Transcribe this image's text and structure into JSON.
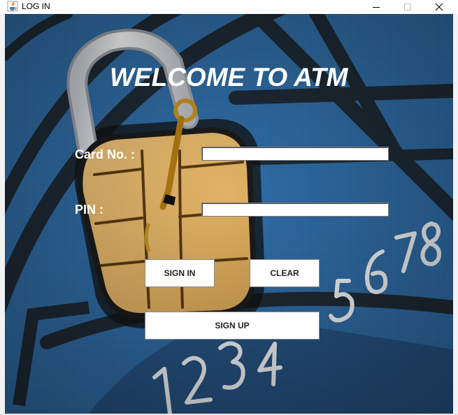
{
  "window": {
    "title": "LOG IN",
    "icons": {
      "app": "java-cup-icon",
      "minimize": "minimize-icon",
      "maximize": "maximize-icon",
      "close": "close-icon"
    }
  },
  "form": {
    "heading": "WELCOME TO ATM",
    "card_label": "Card No.  :",
    "card_value": "",
    "pin_label": "PIN  :",
    "pin_value": ""
  },
  "buttons": {
    "sign_in": "SIGN IN",
    "clear": "CLEAR",
    "sign_up": "SIGN UP"
  },
  "background": {
    "card_digits_top": "5678",
    "card_digits_bottom": "1234"
  },
  "colors": {
    "card_blue": "#2f6ea8",
    "lock_gold": "#e2b566",
    "shackle": "#e8e8ea",
    "text": "#ffffff"
  }
}
